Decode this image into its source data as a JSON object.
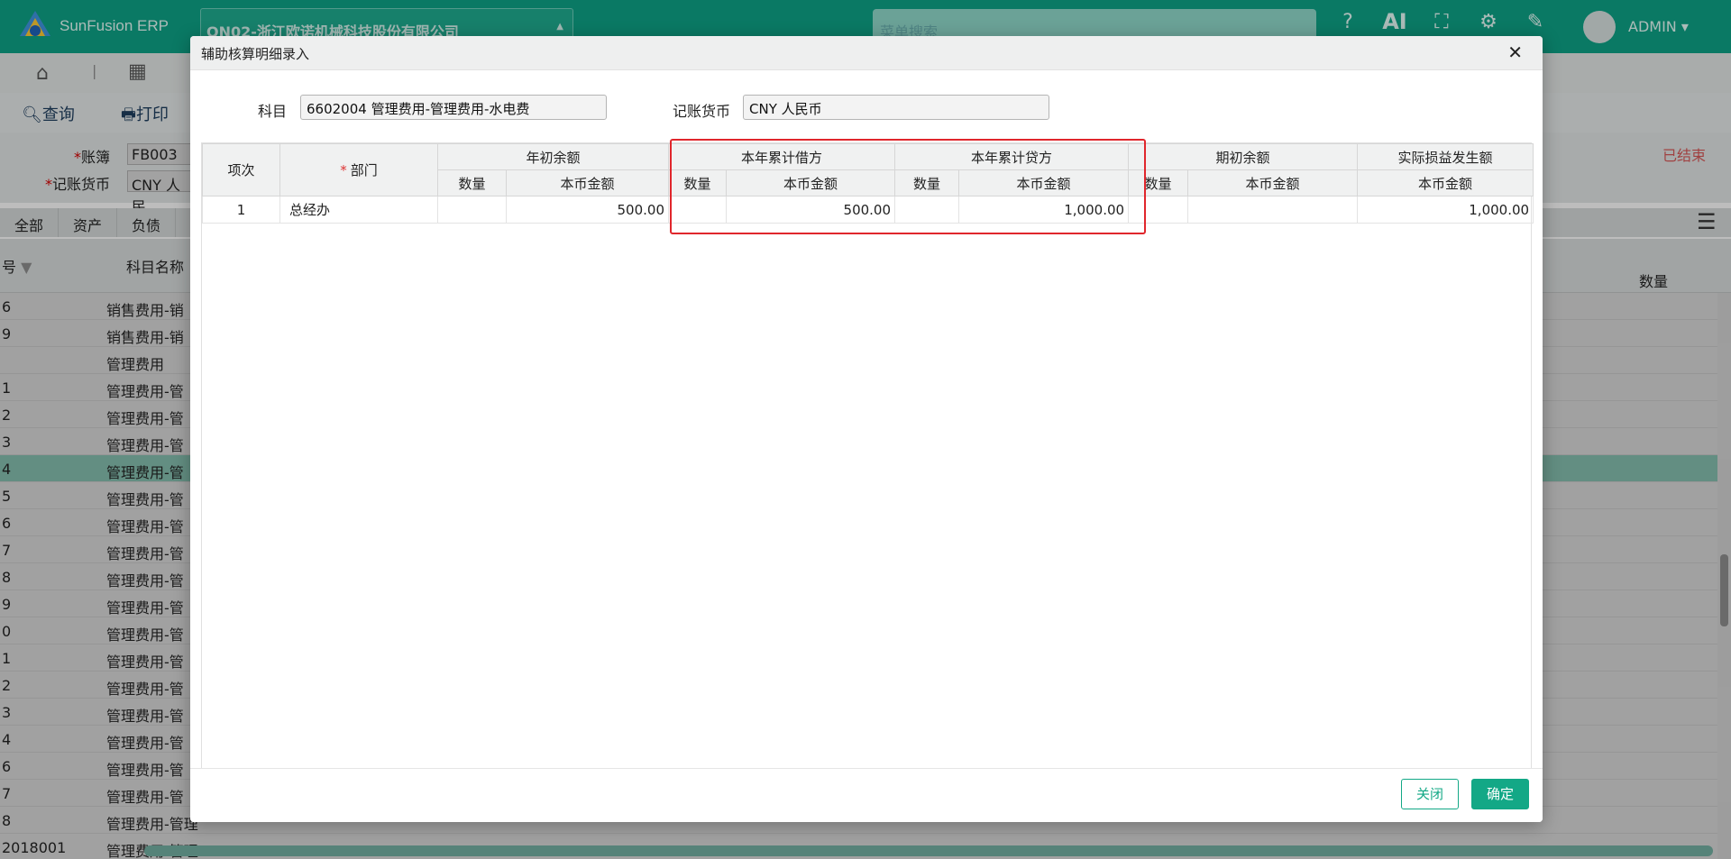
{
  "app": {
    "logo_text": "SunFusion ERP",
    "company": "ON02-浙江欧诺机械科技股份有限公司",
    "menu_search_placeholder": "菜单搜索",
    "ai_label": "AI",
    "user": "ADMIN"
  },
  "toolbar": {
    "query": "查询",
    "print": "打印"
  },
  "filters": {
    "book_label": "账簿",
    "book_value": "FB003",
    "currency_label": "记账货币",
    "currency_value": "CNY 人民",
    "status": "已结束"
  },
  "tabs": [
    "全部",
    "资产",
    "负债"
  ],
  "grid": {
    "col_code": "号",
    "col_name": "科目名称",
    "col_qty": "数量",
    "rows": [
      {
        "code": "6",
        "name": "销售费用-销"
      },
      {
        "code": "9",
        "name": "销售费用-销"
      },
      {
        "code": "",
        "name": "管理费用"
      },
      {
        "code": "1",
        "name": "管理费用-管"
      },
      {
        "code": "2",
        "name": "管理费用-管"
      },
      {
        "code": "3",
        "name": "管理费用-管"
      },
      {
        "code": "4",
        "name": "管理费用-管"
      },
      {
        "code": "5",
        "name": "管理费用-管"
      },
      {
        "code": "6",
        "name": "管理费用-管"
      },
      {
        "code": "7",
        "name": "管理费用-管"
      },
      {
        "code": "8",
        "name": "管理费用-管"
      },
      {
        "code": "9",
        "name": "管理费用-管"
      },
      {
        "code": "0",
        "name": "管理费用-管"
      },
      {
        "code": "1",
        "name": "管理费用-管"
      },
      {
        "code": "2",
        "name": "管理费用-管"
      },
      {
        "code": "3",
        "name": "管理费用-管"
      },
      {
        "code": "4",
        "name": "管理费用-管"
      },
      {
        "code": "6",
        "name": "管理费用-管"
      },
      {
        "code": "7",
        "name": "管理费用-管"
      },
      {
        "code": "8",
        "name": "管理费用-管理"
      },
      {
        "code": "2018001",
        "name": "管理费用-管理"
      }
    ],
    "highlight_row": 6
  },
  "dialog": {
    "title": "辅助核算明细录入",
    "subject_label": "科目",
    "subject_value": "6602004 管理费用-管理费用-水电费",
    "currency_label": "记账货币",
    "currency_value": "CNY 人民币",
    "close_label": "关闭",
    "ok_label": "确定",
    "table": {
      "h_item": "项次",
      "h_dept": "部门",
      "h_open_year": "年初余额",
      "h_ytd_debit": "本年累计借方",
      "h_ytd_credit": "本年累计贷方",
      "h_period_open": "期初余额",
      "h_actual_pl": "实际损益发生额",
      "h_qty": "数量",
      "h_amount": "本币金额",
      "rows": [
        {
          "item": "1",
          "dept": "总经办",
          "open_qty": "",
          "open_amt": "500.00",
          "debit_qty": "",
          "debit_amt": "500.00",
          "credit_qty": "",
          "credit_amt": "1,000.00",
          "period_qty": "",
          "period_amt": "",
          "pl_amt": "1,000.00"
        }
      ]
    }
  },
  "colors": {
    "brand": "#0e9c80",
    "accent_button": "#13a886",
    "highlight_box": "#e0262c"
  }
}
